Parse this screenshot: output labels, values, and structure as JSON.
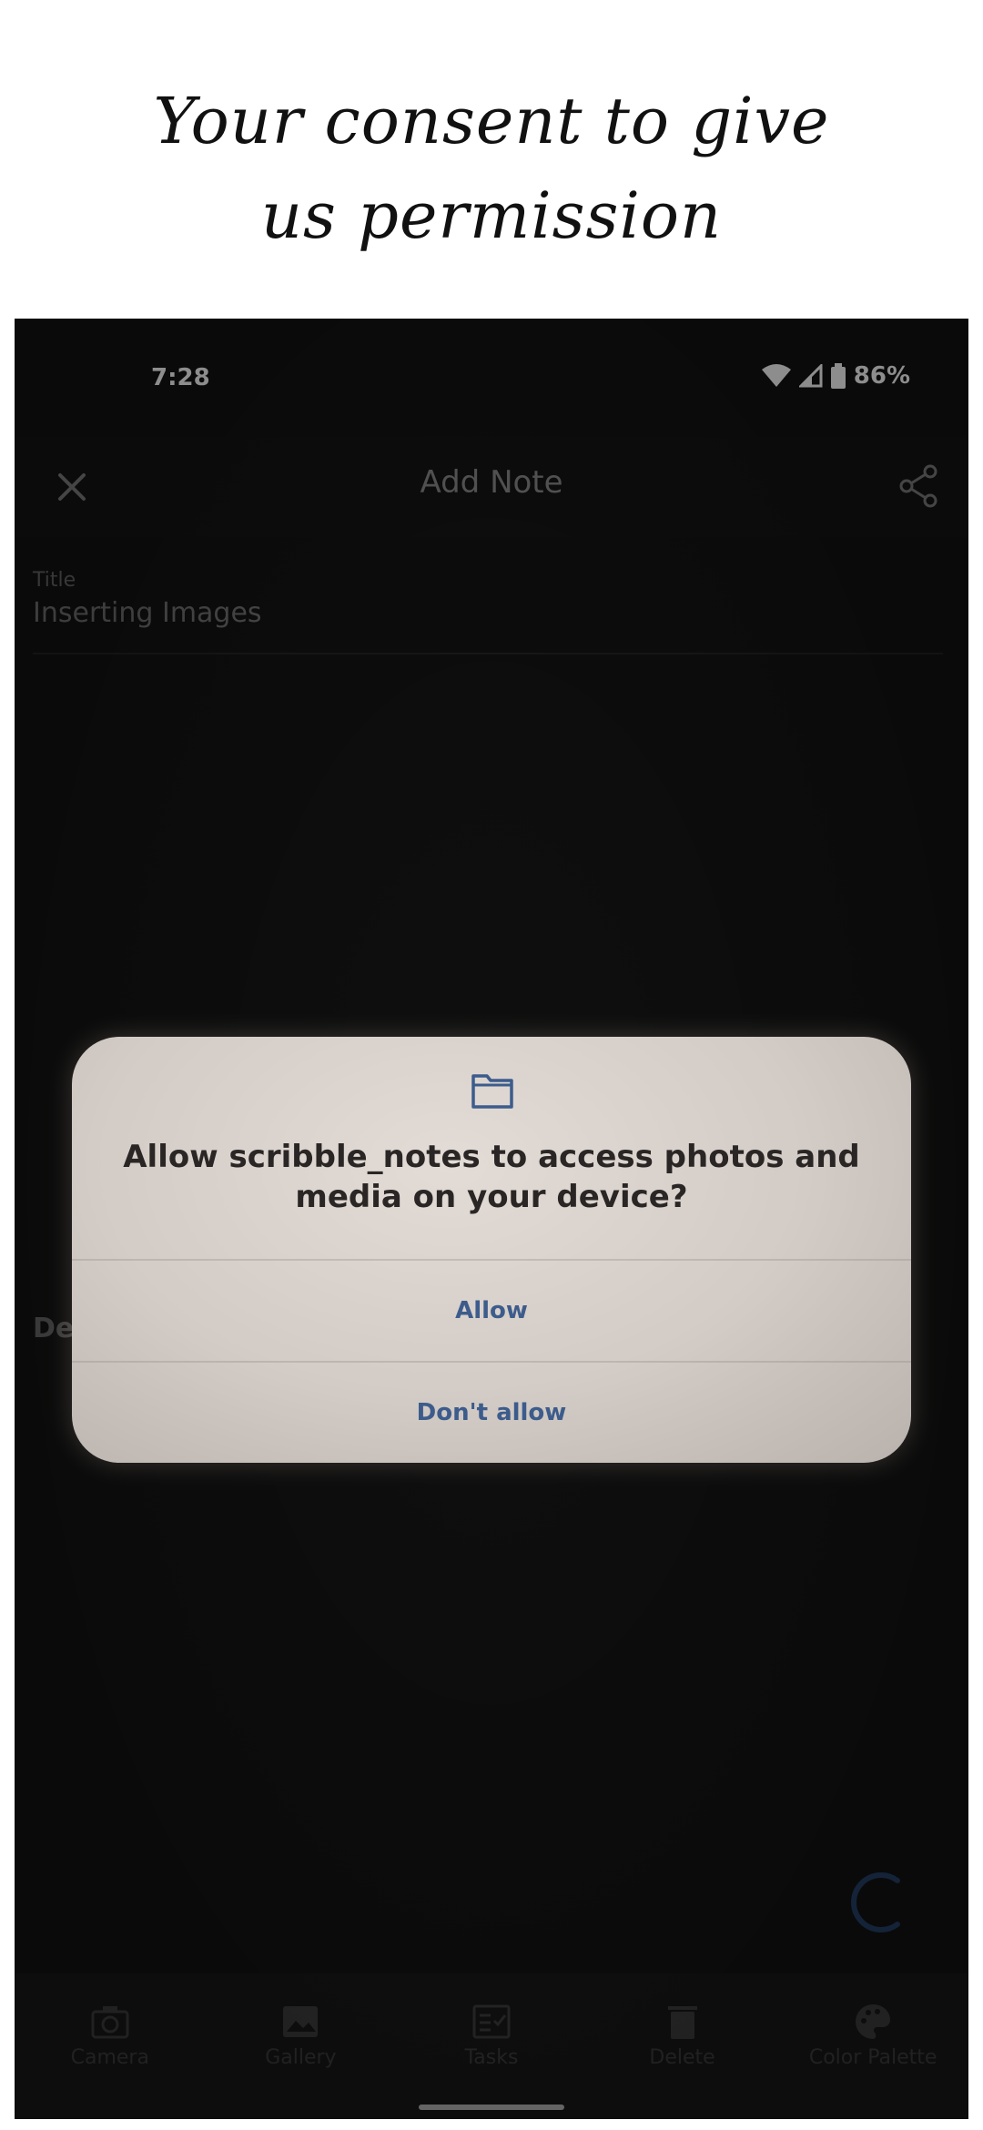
{
  "banner": {
    "line1": "Your consent to give",
    "line2": "us permission"
  },
  "status_bar": {
    "time": "7:28",
    "battery": "86%"
  },
  "app_bar": {
    "title": "Add Note",
    "close_icon": "close-icon",
    "share_icon": "share-icon"
  },
  "note": {
    "title_label": "Title",
    "title_value": "Inserting Images",
    "description_peek": "De"
  },
  "dialog": {
    "icon": "folder-icon",
    "message": "Allow scribble_notes to access photos and media on your device?",
    "allow_label": "Allow",
    "deny_label": "Don't allow",
    "accent_color": "#3c5c8c"
  },
  "bottom_nav": {
    "items": [
      {
        "label": "Camera",
        "icon": "camera-icon"
      },
      {
        "label": "Gallery",
        "icon": "image-icon"
      },
      {
        "label": "Tasks",
        "icon": "checklist-icon"
      },
      {
        "label": "Delete",
        "icon": "trash-icon"
      },
      {
        "label": "Color Palette",
        "icon": "palette-icon"
      }
    ]
  }
}
